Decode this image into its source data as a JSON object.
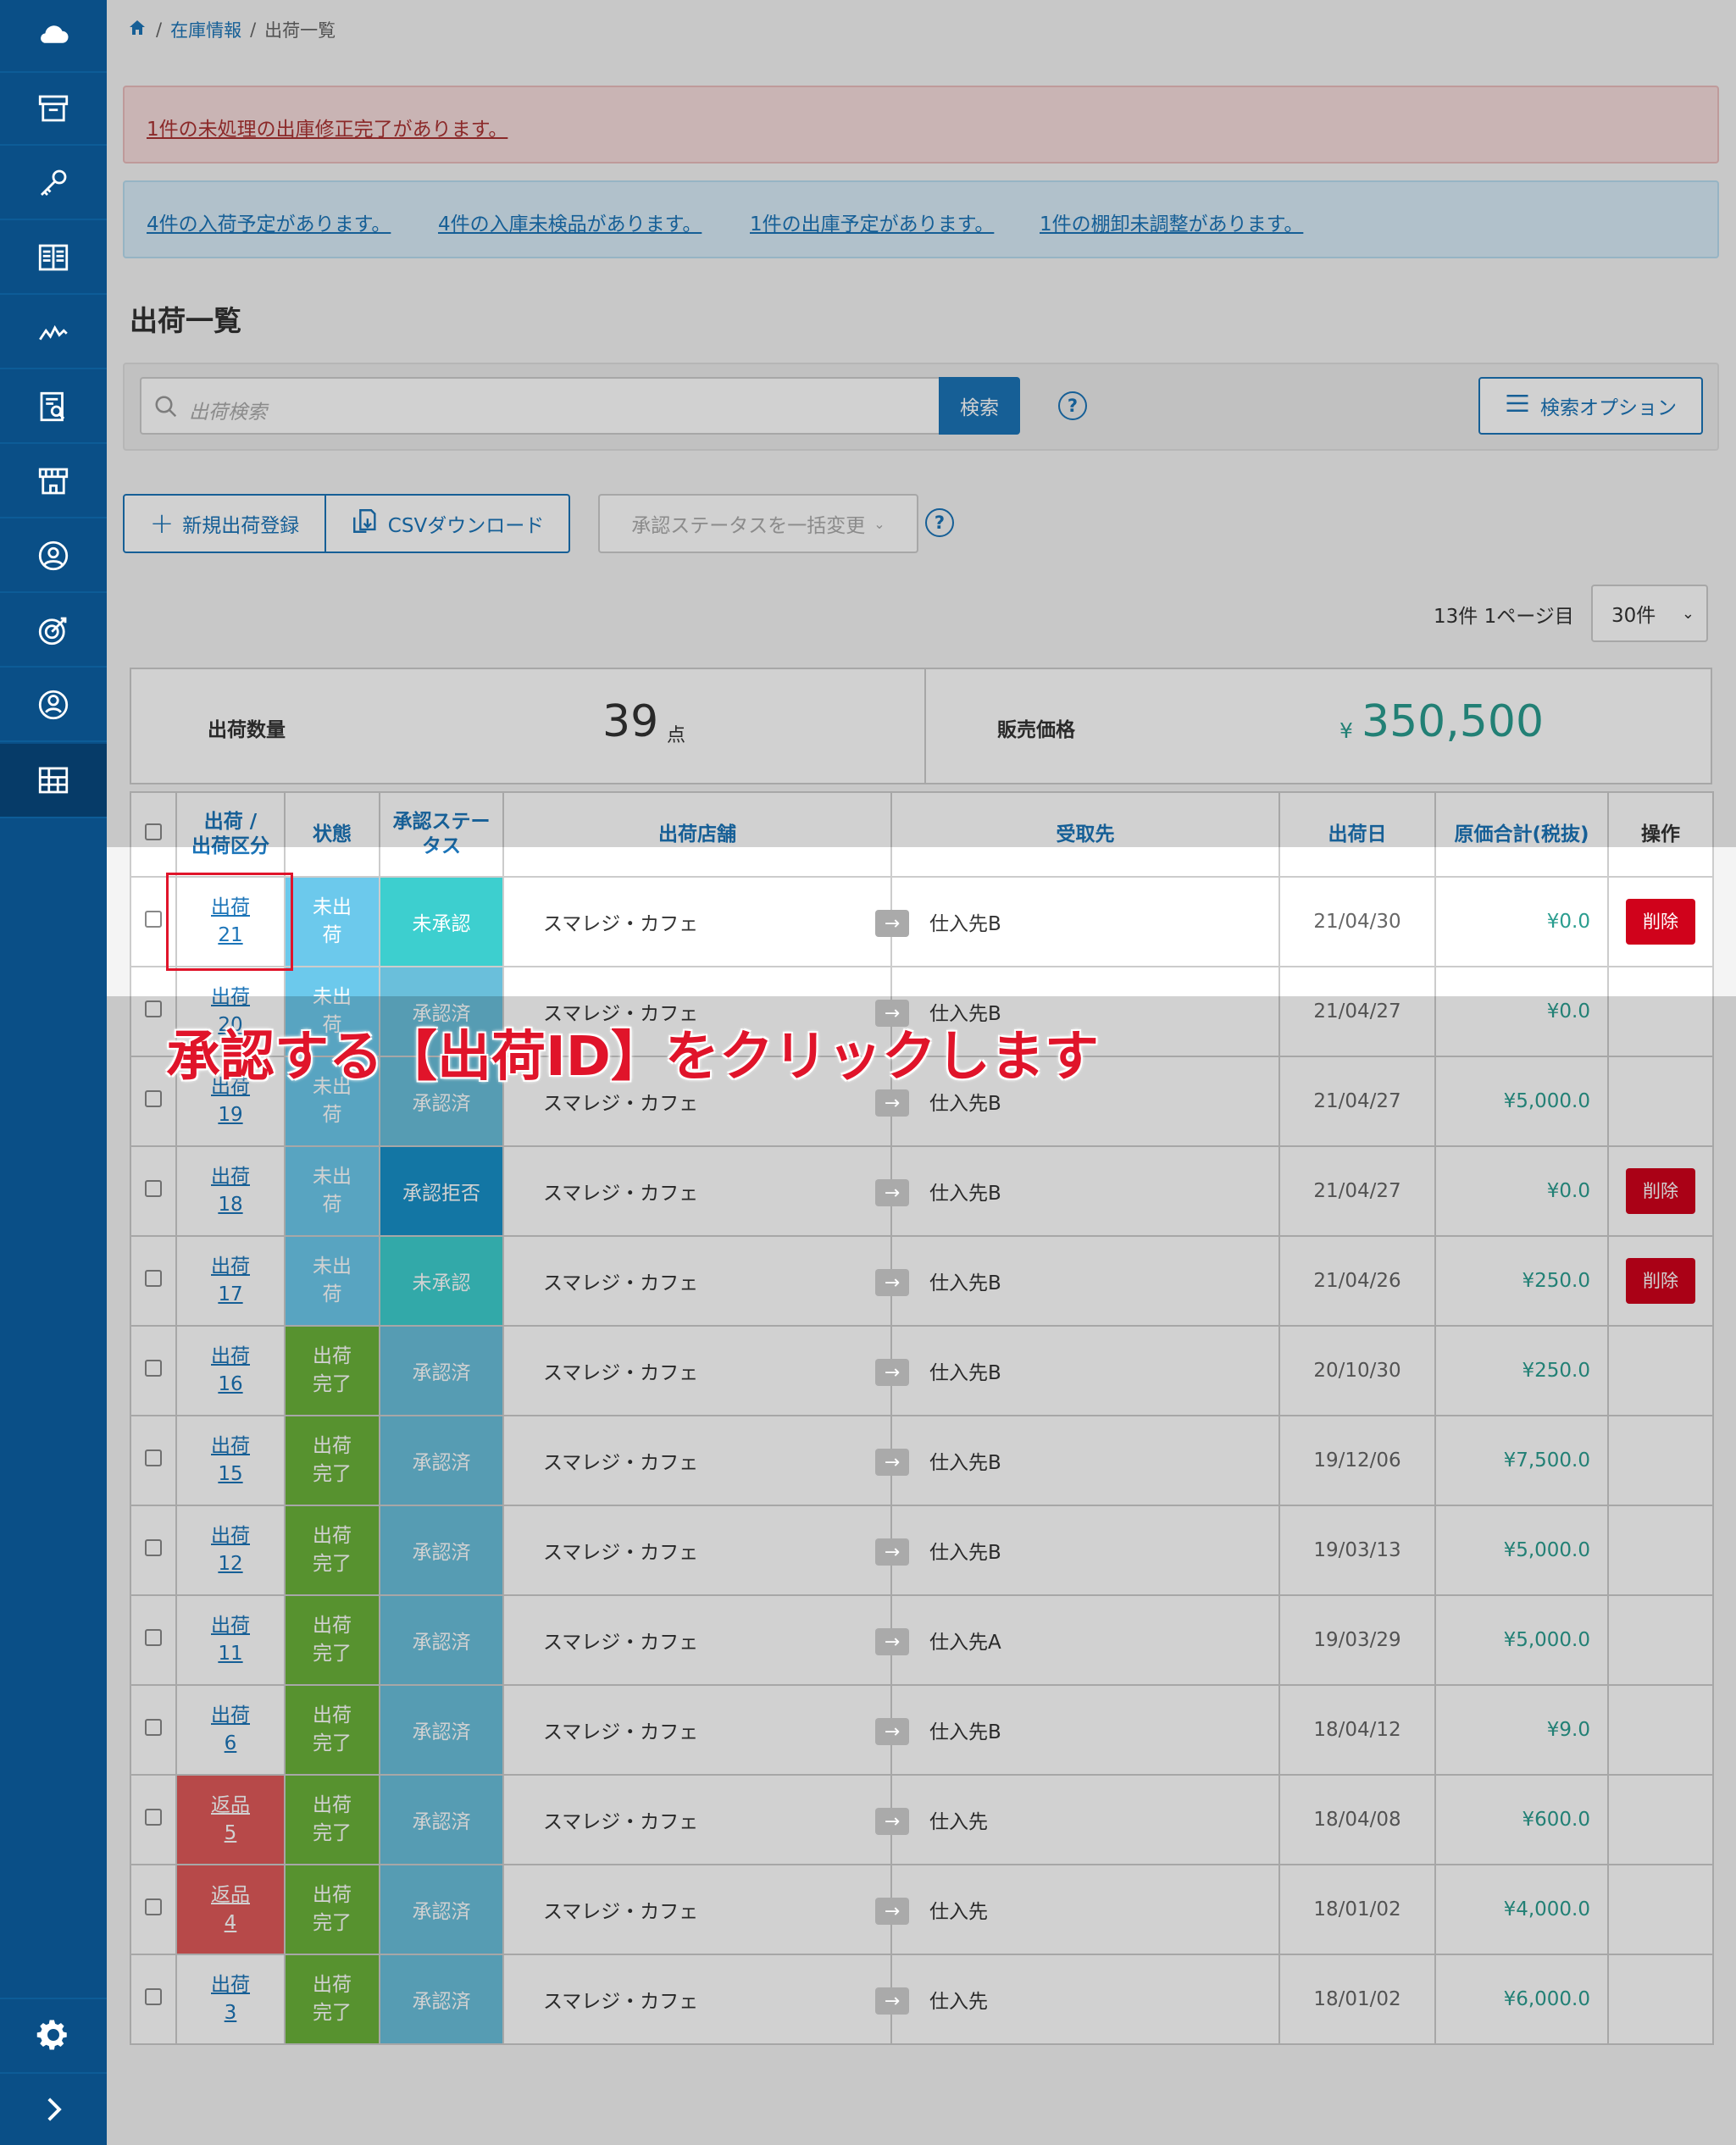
{
  "breadcrumb": {
    "home_icon": "home-icon",
    "parent": "在庫情報",
    "separator": "/",
    "current": "出荷一覧"
  },
  "alerts": {
    "red": "1件の未処理の出庫修正完了があります。",
    "blue": [
      "4件の入荷予定があります。",
      "4件の入庫未検品があります。",
      "1件の出庫予定があります。",
      "1件の棚卸未調整があります。"
    ]
  },
  "page_title": "出荷一覧",
  "search": {
    "placeholder": "出荷検索",
    "button": "検索",
    "help": "?",
    "options_button": "検索オプション"
  },
  "toolbar": {
    "new_button": "新規出荷登録",
    "csv_button": "CSVダウンロード",
    "bulk_select": "承認ステータスを一括変更",
    "help": "?"
  },
  "pagination": {
    "count_text": "13件 1ページ目",
    "per_page": "30件"
  },
  "summary": {
    "qty_label": "出荷数量",
    "qty_value": "39",
    "qty_unit": "点",
    "price_label": "販売価格",
    "price_currency": "¥",
    "price_value": "350,500"
  },
  "table": {
    "headers": {
      "id": "出荷 / 出荷区分",
      "id_line1": "出荷 /",
      "id_line2": "出荷区分",
      "state": "状態",
      "approval_line1": "承認ステー",
      "approval_line2": "タス",
      "store": "出荷店舗",
      "recipient": "受取先",
      "date": "出荷日",
      "cost": "原価合計(税抜)",
      "action": "操作"
    },
    "rows": [
      {
        "type": "出荷",
        "id": "21",
        "state1": "未出",
        "state2": "荷",
        "approval": "未承認",
        "store": "スマレジ・カフェ",
        "recipient": "仕入先B",
        "date": "21/04/30",
        "cost": "¥0.0",
        "action": "削除"
      },
      {
        "type": "出荷",
        "id": "20",
        "state1": "未出",
        "state2": "荷",
        "approval": "承認済",
        "store": "スマレジ・カフェ",
        "recipient": "仕入先B",
        "date": "21/04/27",
        "cost": "¥0.0",
        "action": ""
      },
      {
        "type": "出荷",
        "id": "19",
        "state1": "未出",
        "state2": "荷",
        "approval": "承認済",
        "store": "スマレジ・カフェ",
        "recipient": "仕入先B",
        "date": "21/04/27",
        "cost": "¥5,000.0",
        "action": ""
      },
      {
        "type": "出荷",
        "id": "18",
        "state1": "未出",
        "state2": "荷",
        "approval": "承認拒否",
        "store": "スマレジ・カフェ",
        "recipient": "仕入先B",
        "date": "21/04/27",
        "cost": "¥0.0",
        "action": "削除"
      },
      {
        "type": "出荷",
        "id": "17",
        "state1": "未出",
        "state2": "荷",
        "approval": "未承認",
        "store": "スマレジ・カフェ",
        "recipient": "仕入先B",
        "date": "21/04/26",
        "cost": "¥250.0",
        "action": "削除"
      },
      {
        "type": "出荷",
        "id": "16",
        "state1": "出荷",
        "state2": "完了",
        "approval": "承認済",
        "store": "スマレジ・カフェ",
        "recipient": "仕入先B",
        "date": "20/10/30",
        "cost": "¥250.0",
        "action": ""
      },
      {
        "type": "出荷",
        "id": "15",
        "state1": "出荷",
        "state2": "完了",
        "approval": "承認済",
        "store": "スマレジ・カフェ",
        "recipient": "仕入先B",
        "date": "19/12/06",
        "cost": "¥7,500.0",
        "action": ""
      },
      {
        "type": "出荷",
        "id": "12",
        "state1": "出荷",
        "state2": "完了",
        "approval": "承認済",
        "store": "スマレジ・カフェ",
        "recipient": "仕入先B",
        "date": "19/03/13",
        "cost": "¥5,000.0",
        "action": ""
      },
      {
        "type": "出荷",
        "id": "11",
        "state1": "出荷",
        "state2": "完了",
        "approval": "承認済",
        "store": "スマレジ・カフェ",
        "recipient": "仕入先A",
        "date": "19/03/29",
        "cost": "¥5,000.0",
        "action": ""
      },
      {
        "type": "出荷",
        "id": "6",
        "state1": "出荷",
        "state2": "完了",
        "approval": "承認済",
        "store": "スマレジ・カフェ",
        "recipient": "仕入先B",
        "date": "18/04/12",
        "cost": "¥9.0",
        "action": ""
      },
      {
        "type": "返品",
        "id": "5",
        "state1": "出荷",
        "state2": "完了",
        "approval": "承認済",
        "store": "スマレジ・カフェ",
        "recipient": "仕入先",
        "date": "18/04/08",
        "cost": "¥600.0",
        "action": ""
      },
      {
        "type": "返品",
        "id": "4",
        "state1": "出荷",
        "state2": "完了",
        "approval": "承認済",
        "store": "スマレジ・カフェ",
        "recipient": "仕入先",
        "date": "18/01/02",
        "cost": "¥4,000.0",
        "action": ""
      },
      {
        "type": "出荷",
        "id": "3",
        "state1": "出荷",
        "state2": "完了",
        "approval": "承認済",
        "store": "スマレジ・カフェ",
        "recipient": "仕入先",
        "date": "18/01/02",
        "cost": "¥6,000.0",
        "action": ""
      }
    ]
  },
  "annotation": {
    "caption": "承認する【出荷ID】をクリックします",
    "color": "#e0142a"
  },
  "sidebar": {
    "icons": [
      "cloud-icon",
      "archive-box-icon",
      "key-icon",
      "book-icon",
      "line-chart-icon",
      "report-icon",
      "store-icon",
      "user-circle-icon",
      "target-icon",
      "user-icon",
      "grid-icon"
    ],
    "settings_icon": "gear-icon",
    "expand_icon": "chevron-right-icon"
  },
  "colors": {
    "sidebar": "#0a4f87",
    "accent": "#1b74b8",
    "danger": "#d0021b",
    "success": "#6bb23a"
  }
}
